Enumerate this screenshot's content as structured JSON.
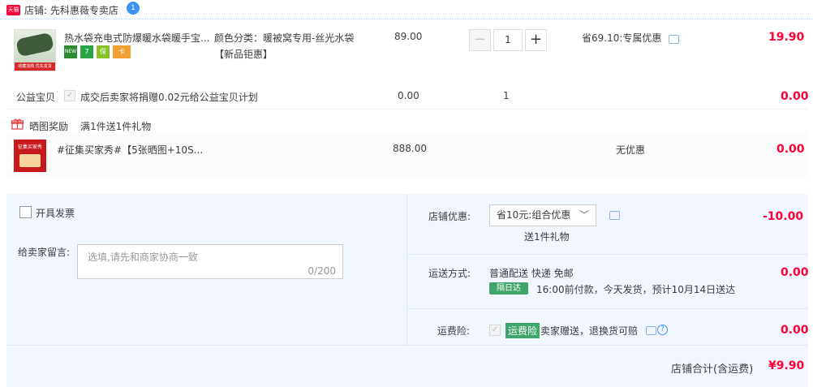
{
  "shop": {
    "badge": "天猫",
    "label": "店铺: 先科惠薇专卖店",
    "ww": "1"
  },
  "item1": {
    "thumb_strip": "收藏加购 优先发货",
    "title": "热水袋充电式防爆暖水袋暖手宝...",
    "tags": [
      "NEW",
      "7",
      "保",
      "卡"
    ],
    "spec_line1": "颜色分类：暖被窝专用-丝光水袋",
    "spec_line2": "【新品钜惠】",
    "price": "89.00",
    "qty": "1",
    "minus": "−",
    "plus": "+",
    "promo": "省69.10:专属优惠",
    "subtotal": "19.90"
  },
  "charity": {
    "label": "公益宝贝",
    "check": "✓",
    "text": "成交后卖家将捐赠0.02元给公益宝贝计划",
    "price": "0.00",
    "qty": "1",
    "subtotal": "0.00"
  },
  "gift": {
    "label": "晒图奖励",
    "rule": "满1件送1件礼物",
    "thumb_text": "征集买家秀",
    "title": "#征集买家秀#【5张晒图+10S...",
    "price": "888.00",
    "promo": "无优惠",
    "subtotal": "0.00"
  },
  "invoice": {
    "label": "开具发票"
  },
  "message": {
    "label": "给卖家留言:",
    "placeholder": "选填,请先和商家协商一致",
    "counter": "0/200"
  },
  "shop_discount": {
    "label": "店铺优惠:",
    "selected": "省10元:组合优惠",
    "gift_note": "送1件礼物",
    "amount": "-10.00"
  },
  "delivery": {
    "label": "运送方式:",
    "method": "普通配送 快递 免邮",
    "badge": "隔日达",
    "note": "16:00前付款，今天发货，预计10月14日送达",
    "amount": "0.00"
  },
  "insurance": {
    "label": "运费险:",
    "badge": "运费险",
    "text": "卖家赠送，退换货可赔",
    "amount": "0.00"
  },
  "total": {
    "label": "店铺合计(含运费)",
    "amount": "¥9.90"
  },
  "colors": {
    "accent_red": "#ff0036",
    "panel_bg": "#f2f7ff",
    "green": "#3fa56a"
  }
}
